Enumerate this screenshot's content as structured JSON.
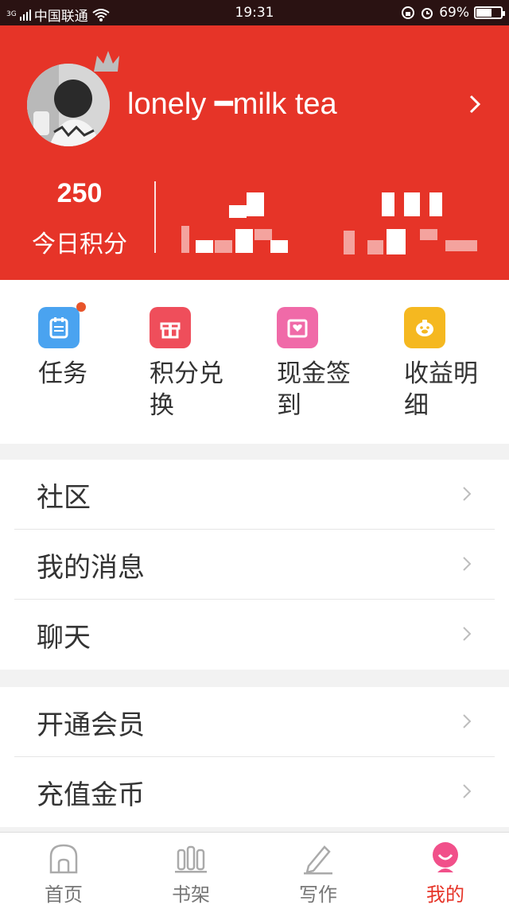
{
  "status_bar": {
    "network": "3G",
    "carrier": "中国联通",
    "time": "19:31",
    "battery": "69%",
    "battery_level": 0.69
  },
  "profile": {
    "username": "lonely ━milk tea",
    "points_value": "250",
    "points_label": "今日积分"
  },
  "quick_actions": [
    {
      "label": "任务",
      "icon": "task-calendar-icon",
      "color": "#4aa3f0",
      "has_dot": true
    },
    {
      "label": "积分兑换",
      "icon": "gift-icon",
      "color": "#ef4e5b"
    },
    {
      "label": "现金签到",
      "icon": "heart-card-icon",
      "color": "#f06aa8"
    },
    {
      "label": "收益明细",
      "icon": "piggy-bank-icon",
      "color": "#f5b820"
    }
  ],
  "menu_group_1": [
    {
      "label": "社区"
    },
    {
      "label": "我的消息"
    },
    {
      "label": "聊天"
    }
  ],
  "menu_group_2": [
    {
      "label": "开通会员"
    },
    {
      "label": "充值金币"
    }
  ],
  "tabs": [
    {
      "label": "首页",
      "icon": "home-icon"
    },
    {
      "label": "书架",
      "icon": "bookshelf-icon"
    },
    {
      "label": "写作",
      "icon": "pencil-icon"
    },
    {
      "label": "我的",
      "icon": "profile-icon",
      "active": true
    }
  ],
  "colors": {
    "brand_red": "#e63428",
    "active_tab": "#e63428",
    "status_bar": "#2a1212"
  }
}
